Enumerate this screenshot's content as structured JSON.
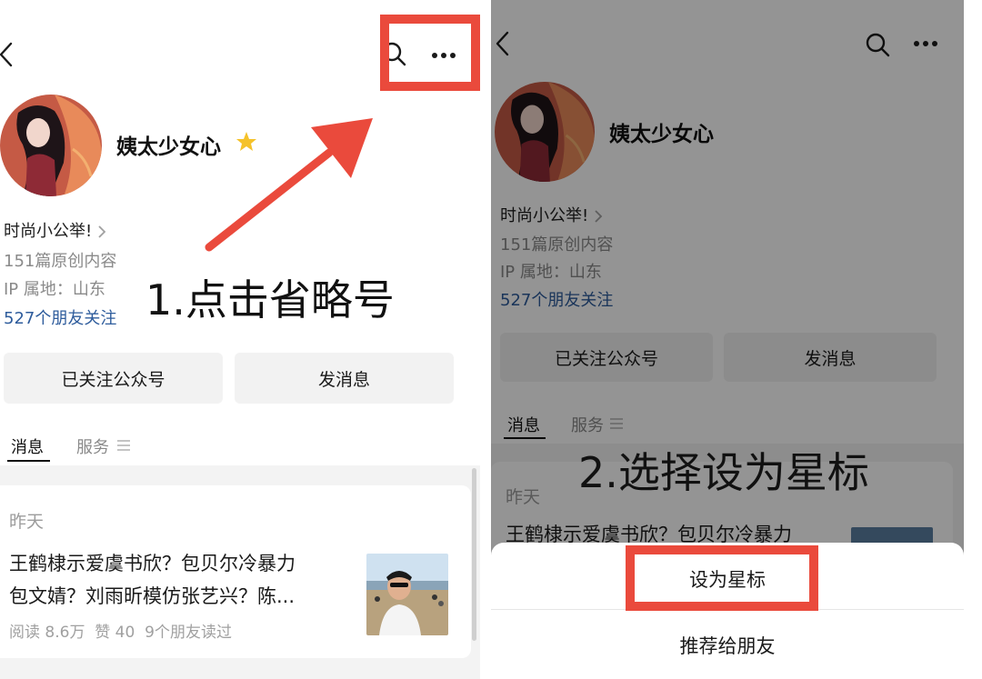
{
  "left": {
    "account_name": "姨太少女心",
    "category": "时尚小公举!",
    "articles": "151篇原创内容",
    "ip_location": "IP 属地：山东",
    "friends_follow": "527个朋友关注",
    "follow_button": "已关注公众号",
    "message_button": "发消息",
    "tabs": [
      {
        "label": "消息"
      },
      {
        "label": "服务"
      }
    ],
    "post": {
      "date": "昨天",
      "title_line1": "王鹤棣示爱虞书欣？包贝尔冷暴力",
      "title_line2": "包文婧？刘雨昕模仿张艺兴？陈...",
      "reads": "阅读 8.6万",
      "likes": "赞 40",
      "friends_read": "9个朋友读过"
    },
    "instruction": "1.点击省略号"
  },
  "right": {
    "account_name": "姨太少女心",
    "category": "时尚小公举!",
    "articles": "151篇原创内容",
    "ip_location": "IP 属地：山东",
    "friends_follow": "527个朋友关注",
    "follow_button": "已关注公众号",
    "message_button": "发消息",
    "tabs": [
      {
        "label": "消息"
      },
      {
        "label": "服务"
      }
    ],
    "post": {
      "date": "昨天",
      "title_partial": "王鹤棣示爱虞书欣？包贝尔冷暴力"
    },
    "instruction": "2.选择设为星标",
    "sheet": {
      "set_star": "设为星标",
      "recommend": "推荐给朋友"
    }
  },
  "colors": {
    "highlight": "#ea4a3c",
    "link_blue": "#2e5c9c",
    "star_yellow": "#f5c22a"
  },
  "icons": [
    "back-icon",
    "search-icon",
    "more-icon",
    "star-icon",
    "chevron-right-icon",
    "menu-icon"
  ]
}
